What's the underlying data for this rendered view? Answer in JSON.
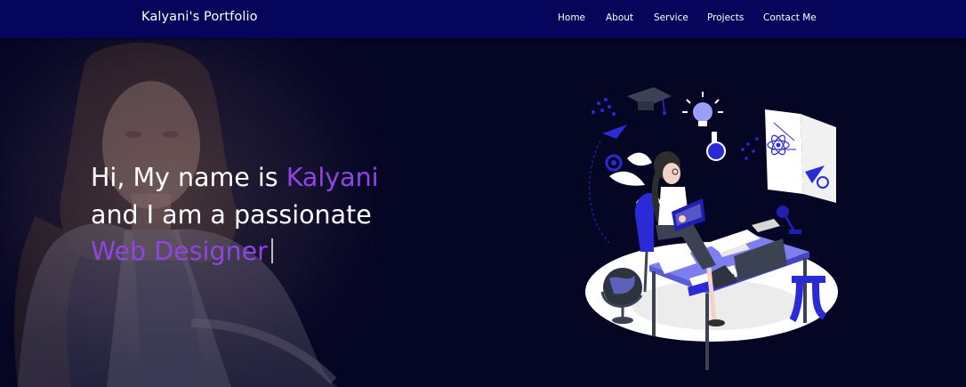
{
  "navbar": {
    "brand": "Kalyani's Portfolio",
    "links": [
      {
        "label": "Home"
      },
      {
        "label": "About"
      },
      {
        "label": "Service"
      },
      {
        "label": "Projects"
      },
      {
        "label": "Contact Me"
      }
    ]
  },
  "hero": {
    "line1_prefix": "Hi, My name is ",
    "name": "Kalyani",
    "line2": "and I am a passionate",
    "role": "Web Designer"
  },
  "colors": {
    "navbar_bg": "#05055c",
    "page_bg": "#050524",
    "accent": "#8f45e6",
    "illustration_blue": "#2a2bd6"
  },
  "icons": [
    "graduation-cap-icon",
    "lightbulb-icon",
    "paper-plane-icon",
    "gear-icon",
    "atom-icon",
    "globe-icon",
    "pi-icon",
    "book-icon",
    "laptop-icon",
    "flask-icon"
  ]
}
